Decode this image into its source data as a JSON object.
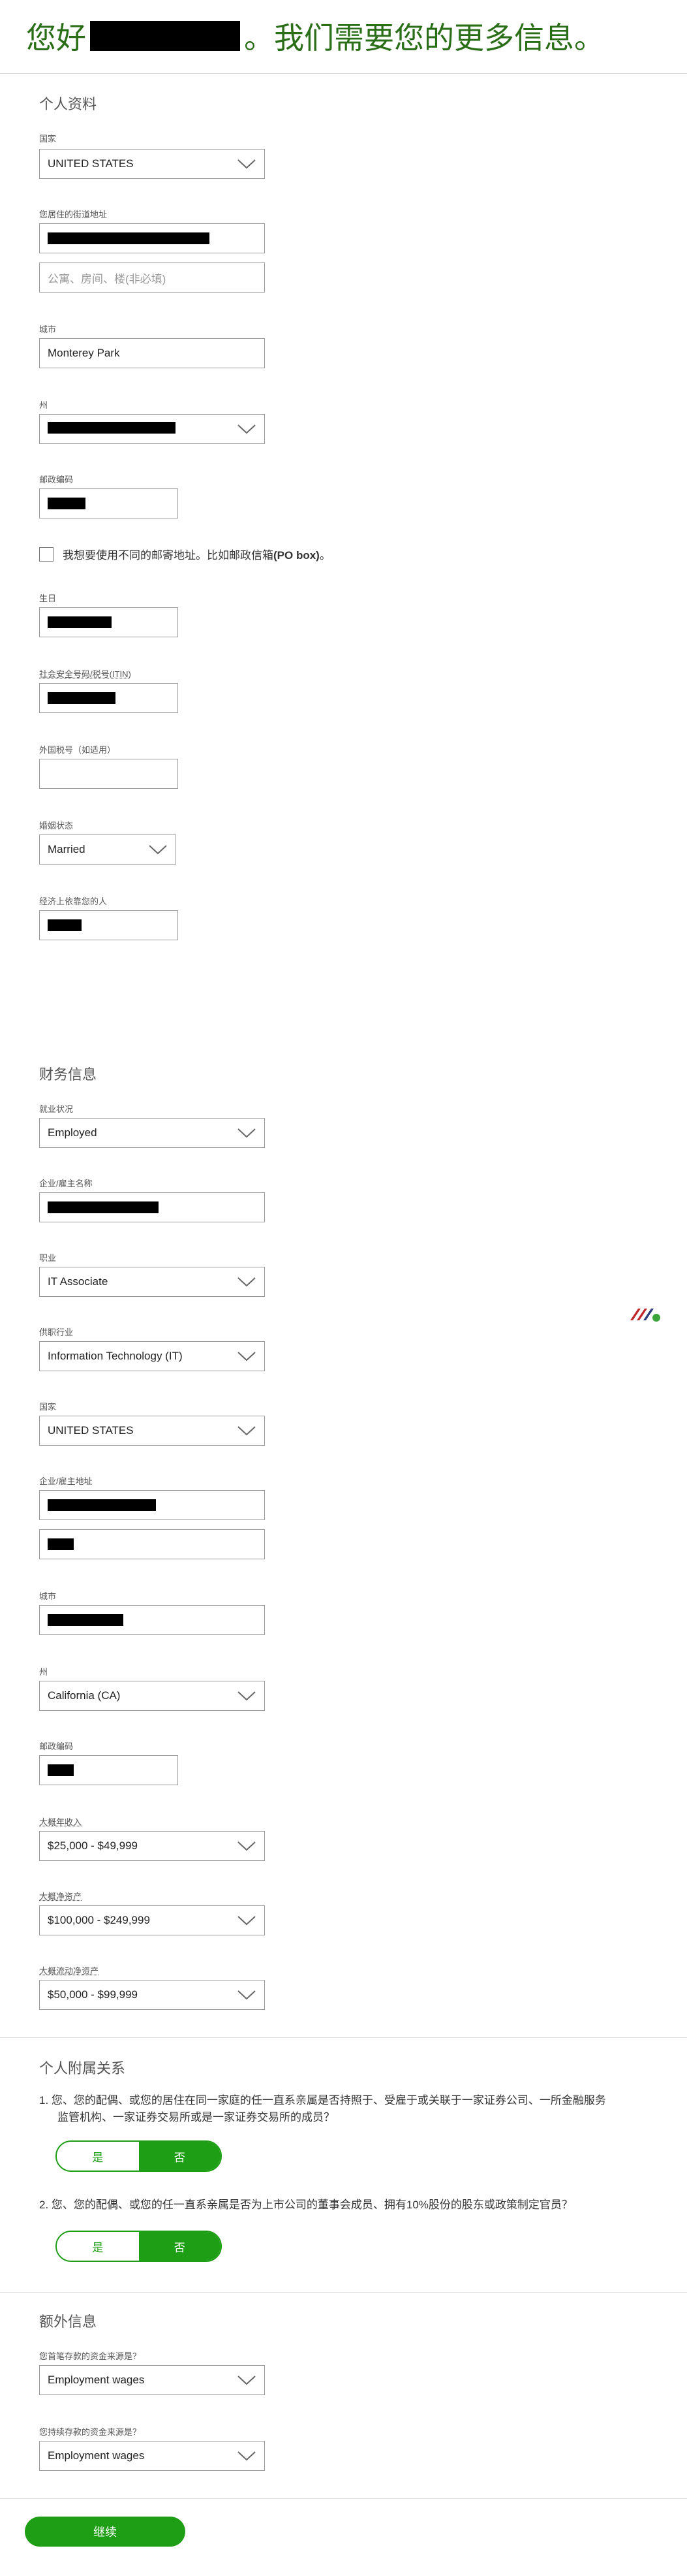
{
  "header": {
    "greeting_prefix": "您好",
    "greeting_suffix": "。我们需要您的更多信息。"
  },
  "personal": {
    "title": "个人资料",
    "country_label": "国家",
    "country_value": "UNITED STATES",
    "address_label": "您居住的街道地址",
    "address2_placeholder": "公寓、房间、楼(非必填)",
    "city_label": "城市",
    "city_value": "Monterey Park",
    "state_label": "州",
    "zip_label": "邮政编码",
    "mailing_checkbox_prefix": "我想要使用不同的邮寄地址。比如邮政信箱",
    "mailing_checkbox_bold": "(PO box)",
    "mailing_checkbox_suffix": "。",
    "birthday_label": "生日",
    "ssn_label": "社会安全号码/税号(ITIN)",
    "foreign_tax_label": "外国税号（如适用）",
    "marital_label": "婚姻状态",
    "marital_value": "Married",
    "dependents_label": "经济上依靠您的人"
  },
  "financial": {
    "title": "财务信息",
    "employment_label": "就业状况",
    "employment_value": "Employed",
    "employer_label": "企业/雇主名称",
    "occupation_label": "职业",
    "occupation_value": "IT Associate",
    "industry_label": "供职行业",
    "industry_value": "Information Technology (IT)",
    "country_label": "国家",
    "country_value": "UNITED STATES",
    "employer_address_label": "企业/雇主地址",
    "city_label": "城市",
    "state_label": "州",
    "state_value": "California (CA)",
    "zip_label": "邮政编码",
    "income_label": "大概年收入",
    "income_value": "$25,000 - $49,999",
    "net_worth_label": "大概净资产",
    "net_worth_value": "$100,000 - $249,999",
    "liquid_label": "大概流动净资产",
    "liquid_value": "$50,000 - $99,999"
  },
  "affiliations": {
    "title": "个人附属关系",
    "q1_line1": "1.  您、您的配偶、或您的居住在同一家庭的任一直系亲属是否持照于、受雇于或关联于一家证券公司、一所金融服务",
    "q1_line2": "监管机构、一家证券交易所或是一家证券交易所的成员？",
    "q2": "2.  您、您的配偶、或您的任一直系亲属是否为上市公司的董事会成员、拥有10%股份的股东或政策制定官员？",
    "yes_label": "是",
    "no_label": "否"
  },
  "extra": {
    "title": "额外信息",
    "fund_source_label": "您首笔存款的资金来源是？",
    "fund_source_value": "Employment wages",
    "ongoing_source_label": "您持续存款的资金来源是？",
    "ongoing_source_value": "Employment wages"
  },
  "continue_label": "继续",
  "colors": {
    "brand_green": "#1e9e14",
    "heading_green": "#2a6e18"
  }
}
